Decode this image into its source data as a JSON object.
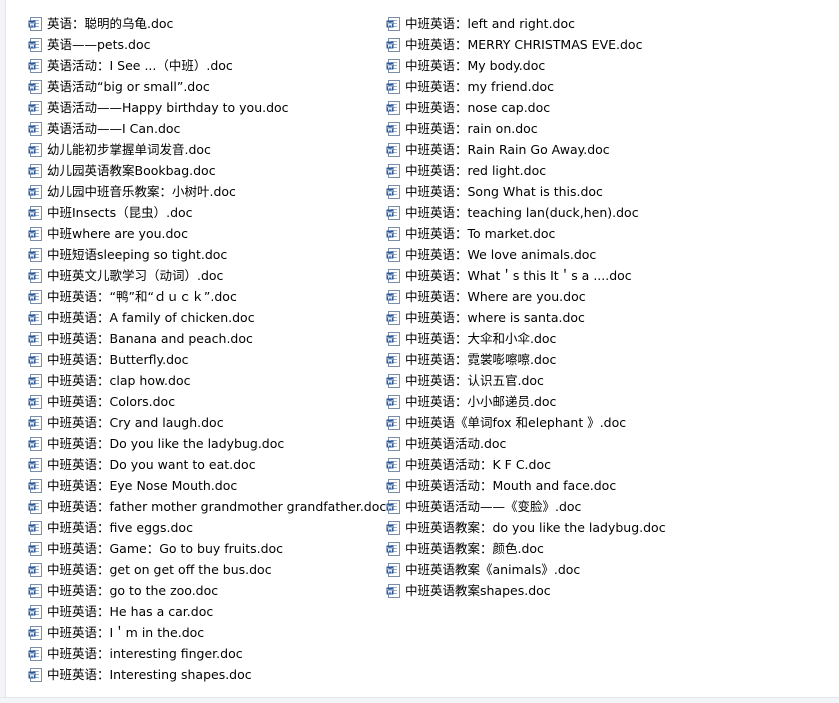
{
  "file_icon": "word-doc-icon",
  "colors": {
    "icon_blue": "#2b5797",
    "icon_page": "#ffffff",
    "icon_border": "#7a8ea8"
  },
  "files": {
    "left": [
      "英语：聪明的乌龟.doc",
      "英语——pets.doc",
      "英语活动：I See ...（中班）.doc",
      "英语活动“big or small”.doc",
      "英语活动——Happy birthday to you.doc",
      "英语活动——I Can.doc",
      "幼儿能初步掌握单词发音.doc",
      "幼儿园英语教案Bookbag.doc",
      "幼儿园中班音乐教案：小树叶.doc",
      "中班Insects（昆虫）.doc",
      "中班where are you.doc",
      "中班短语sleeping so tight.doc",
      "中班英文儿歌学习（动词）.doc",
      "中班英语：“鸭”和“ｄｕｃｋ”.doc",
      "中班英语：A family of chicken.doc",
      "中班英语：Banana and peach.doc",
      "中班英语：Butterfly.doc",
      "中班英语：clap how.doc",
      "中班英语：Colors.doc",
      "中班英语：Cry and laugh.doc",
      "中班英语：Do you like the ladybug.doc",
      "中班英语：Do you want to eat.doc",
      "中班英语：Eye Nose Mouth.doc",
      "中班英语：father mother grandmother grandfather.doc",
      "中班英语：five eggs.doc",
      "中班英语：Game：Go to buy fruits.doc",
      "中班英语：get on get off the bus.doc",
      "中班英语：go to the zoo.doc",
      "中班英语：He has a car.doc",
      "中班英语：I＇m in the.doc",
      "中班英语：interesting finger.doc",
      "中班英语：Interesting shapes.doc"
    ],
    "right": [
      "中班英语：left and right.doc",
      "中班英语：MERRY CHRISTMAS EVE.doc",
      "中班英语：My body.doc",
      "中班英语：my friend.doc",
      "中班英语：nose cap.doc",
      "中班英语：rain on.doc",
      "中班英语：Rain Rain Go Away.doc",
      "中班英语：red light.doc",
      "中班英语：Song What is this.doc",
      "中班英语：teaching lan(duck,hen).doc",
      "中班英语：To market.doc",
      "中班英语：We love animals.doc",
      "中班英语：What＇s this It＇s a ....doc",
      "中班英语：Where are you.doc",
      "中班英语：where is santa.doc",
      "中班英语：大伞和小伞.doc",
      "中班英语：霓裳嘭嚓嚓.doc",
      "中班英语：认识五官.doc",
      "中班英语：小小邮递员.doc",
      "中班英语《单词fox 和elephant 》.doc",
      "中班英语活动.doc",
      "中班英语活动：K F C.doc",
      "中班英语活动：Mouth and face.doc",
      "中班英语活动——《变脸》.doc",
      "中班英语教案：do you like the ladybug.doc",
      "中班英语教案：颜色.doc",
      "中班英语教案《animals》.doc",
      "中班英语教案shapes.doc"
    ]
  }
}
